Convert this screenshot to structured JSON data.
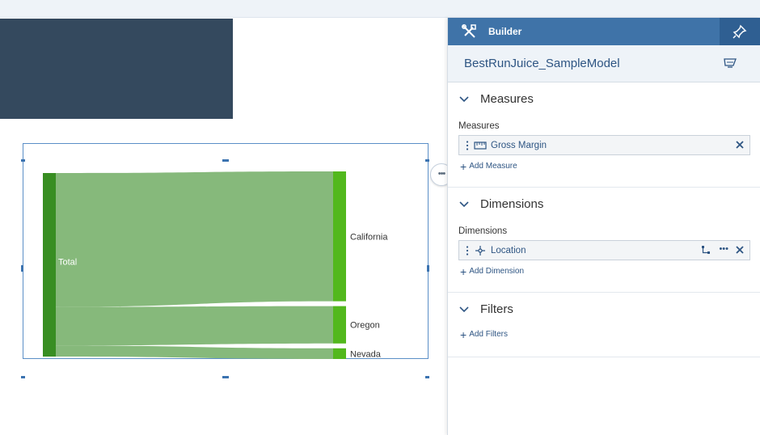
{
  "builder": {
    "title": "Builder",
    "model_name": "BestRunJuice_SampleModel",
    "sections": {
      "measures": {
        "title": "Measures",
        "field_label": "Measures",
        "token_label": "Gross Margin",
        "add_label": "Add Measure"
      },
      "dimensions": {
        "title": "Dimensions",
        "field_label": "Dimensions",
        "token_label": "Location",
        "more_label": "•••",
        "add_label": "Add Dimension"
      },
      "filters": {
        "title": "Filters",
        "add_label": "Add Filters"
      }
    }
  },
  "chart": {
    "more_button_label": "•••"
  },
  "chart_data": {
    "type": "sankey",
    "source": "Total",
    "targets": [
      {
        "name": "California",
        "value": 73
      },
      {
        "name": "Oregon",
        "value": 21
      },
      {
        "name": "Nevada",
        "value": 6
      }
    ],
    "colors": {
      "source_node": "#388e22",
      "target_node": "#52b81d",
      "link": "#86b97b"
    }
  },
  "colors": {
    "header": "#3f73a8",
    "header_pin": "#2f5f92",
    "accent_text": "#2e5583",
    "dark_tile": "#34495e"
  }
}
